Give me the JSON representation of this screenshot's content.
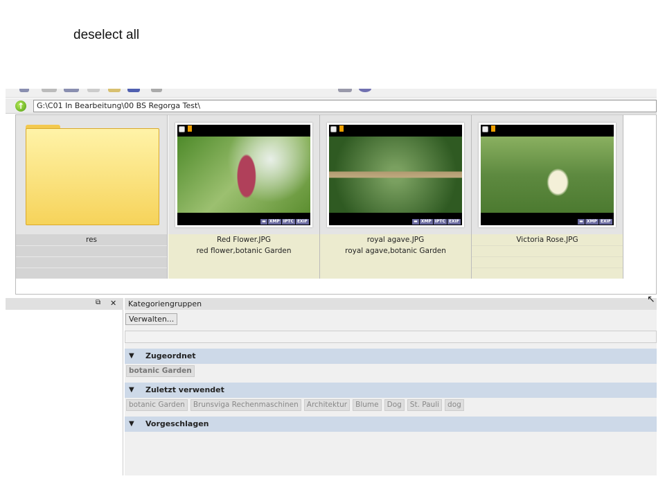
{
  "caption": "deselect all",
  "path": "G:\\C01 In Bearbeitung\\00 BS Regorga Test\\",
  "thumbnails": [
    {
      "type": "folder",
      "name": "res"
    },
    {
      "type": "image",
      "name": "Red Flower.JPG",
      "keywords": "red flower,botanic Garden",
      "badges": [
        "XMP",
        "IPTC",
        "EXIF"
      ]
    },
    {
      "type": "image",
      "name": "royal agave.JPG",
      "keywords": "royal agave,botanic Garden",
      "badges": [
        "XMP",
        "IPTC",
        "EXIF"
      ]
    },
    {
      "type": "image",
      "name": "Victoria Rose.JPG",
      "keywords": "",
      "badges": [
        "XMP",
        "EXIF"
      ]
    }
  ],
  "panel": {
    "title": "Kategoriengruppen",
    "manage_label": "Verwalten...",
    "sections": [
      {
        "title": "Zugeordnet",
        "tags": [
          "botanic Garden"
        ]
      },
      {
        "title": "Zuletzt verwendet",
        "tags": [
          "botanic Garden",
          "Brunsviga Rechenmaschinen",
          "Architektur",
          "Blume",
          "Dog",
          "St. Pauli",
          "dog"
        ]
      },
      {
        "title": "Vorgeschlagen",
        "tags": []
      }
    ]
  }
}
